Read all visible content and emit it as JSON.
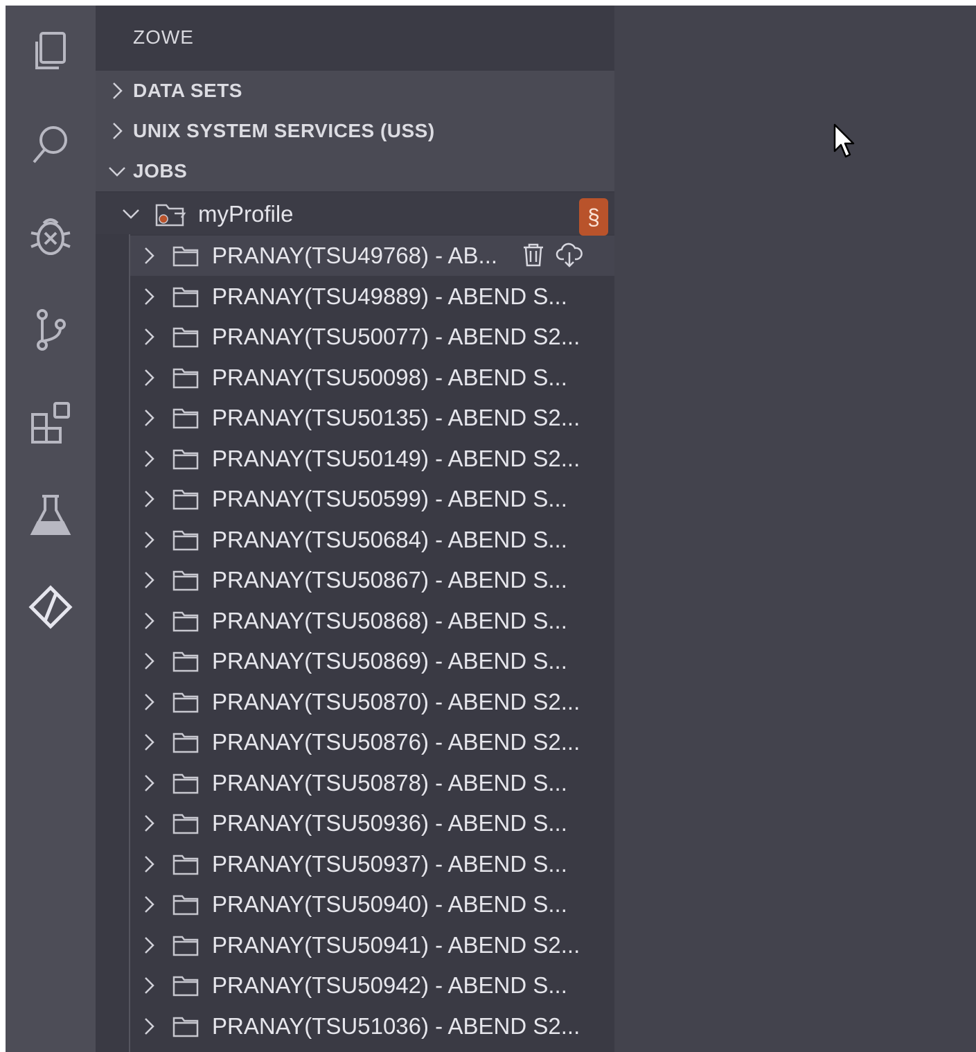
{
  "activity_bar": {
    "icons": [
      "explorer-icon",
      "search-icon",
      "debug-icon",
      "source-control-icon",
      "extensions-icon",
      "testing-icon",
      "zowe-icon"
    ]
  },
  "sidebar": {
    "title": "ZOWE",
    "sections": [
      {
        "label": "DATA SETS",
        "expanded": false
      },
      {
        "label": "UNIX SYSTEM SERVICES (USS)",
        "expanded": false
      },
      {
        "label": "JOBS",
        "expanded": true
      }
    ]
  },
  "profile": {
    "label": "myProfile",
    "badge": "§"
  },
  "jobs": [
    {
      "label": "PRANAY(TSU49768) - AB..."
    },
    {
      "label": "PRANAY(TSU49889) - ABEND S..."
    },
    {
      "label": "PRANAY(TSU50077) - ABEND S2..."
    },
    {
      "label": "PRANAY(TSU50098) - ABEND S..."
    },
    {
      "label": "PRANAY(TSU50135) - ABEND S2..."
    },
    {
      "label": "PRANAY(TSU50149) - ABEND S2..."
    },
    {
      "label": "PRANAY(TSU50599) - ABEND S..."
    },
    {
      "label": "PRANAY(TSU50684) - ABEND S..."
    },
    {
      "label": "PRANAY(TSU50867) - ABEND S..."
    },
    {
      "label": "PRANAY(TSU50868) - ABEND S..."
    },
    {
      "label": "PRANAY(TSU50869) - ABEND S..."
    },
    {
      "label": "PRANAY(TSU50870) - ABEND S2..."
    },
    {
      "label": "PRANAY(TSU50876) - ABEND S2..."
    },
    {
      "label": "PRANAY(TSU50878) - ABEND S..."
    },
    {
      "label": "PRANAY(TSU50936) - ABEND S..."
    },
    {
      "label": "PRANAY(TSU50937) - ABEND S..."
    },
    {
      "label": "PRANAY(TSU50940) - ABEND S..."
    },
    {
      "label": "PRANAY(TSU50941) - ABEND S2..."
    },
    {
      "label": "PRANAY(TSU50942) - ABEND S..."
    },
    {
      "label": "PRANAY(TSU51036) - ABEND S2..."
    }
  ],
  "selected_row_actions": [
    "delete-icon",
    "download-icon"
  ],
  "colors": {
    "background": "#43434d",
    "activity_bar": "#4d4d57",
    "sidebar": "#3a3a44",
    "section_header": "#4a4a54",
    "badge": "#b9532b"
  }
}
